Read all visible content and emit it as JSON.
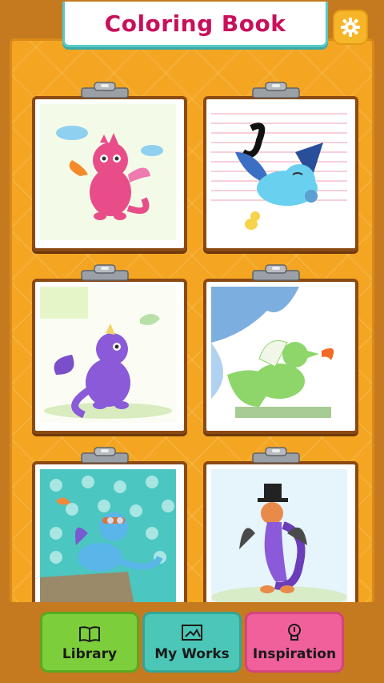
{
  "header": {
    "title": "Coloring Book"
  },
  "settings": {
    "icon": "gear-icon"
  },
  "cards": [
    {
      "name": "card-dragon-pink"
    },
    {
      "name": "card-dragon-blue-sleeping"
    },
    {
      "name": "card-dragon-purple-bird"
    },
    {
      "name": "card-dragon-green-fire"
    },
    {
      "name": "card-dragon-aviator"
    },
    {
      "name": "card-dragon-tophat"
    }
  ],
  "tabs": [
    {
      "label": "Library",
      "icon": "book-icon",
      "color": "#7ccf3a"
    },
    {
      "label": "My Works",
      "icon": "picture-icon",
      "color": "#4cc7b7"
    },
    {
      "label": "Inspiration",
      "icon": "lightbulb-icon",
      "color": "#f0609b"
    }
  ]
}
